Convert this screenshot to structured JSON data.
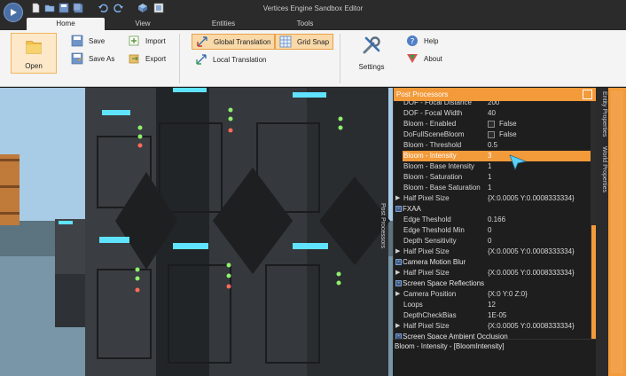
{
  "window": {
    "title": "Vertices Engine Sandbox Editor"
  },
  "menu_tabs": [
    {
      "label": "Home"
    },
    {
      "label": "View"
    },
    {
      "label": "Entities"
    },
    {
      "label": "Tools"
    }
  ],
  "ribbon": {
    "open": "Open",
    "save": "Save",
    "save_as": "Save As",
    "import": "Import",
    "export": "Export",
    "global_translation": "Global Translation",
    "local_translation": "Local Translation",
    "grid_snap": "Grid Snap",
    "settings": "Settings",
    "help": "Help",
    "about": "About"
  },
  "viewport": {
    "side_label": "Post Processors"
  },
  "panel": {
    "title": "Post Processors",
    "rows": [
      {
        "name": "DOF - Focal Distance",
        "value": "200"
      },
      {
        "name": "DOF - Focal Width",
        "value": "40"
      },
      {
        "name": "Bloom - Enabled",
        "value": "False"
      },
      {
        "name": "DoFullSceneBloom",
        "value": "False"
      },
      {
        "name": "Bloom - Threshold",
        "value": "0.5"
      },
      {
        "name": "Bloom - Intensity",
        "value": "3"
      },
      {
        "name": "Bloom - Base Intensity",
        "value": "1"
      },
      {
        "name": "Bloom - Saturation",
        "value": "1"
      },
      {
        "name": "Bloom - Base Saturation",
        "value": "1"
      },
      {
        "name": "Half Pixel Size",
        "value": "{X:0.0005 Y:0.0008333334}"
      },
      {
        "name": "FXAA",
        "value": ""
      },
      {
        "name": "Edge Theshold",
        "value": "0.166"
      },
      {
        "name": "Edge Theshold Min",
        "value": "0"
      },
      {
        "name": "Depth Sensitivity",
        "value": "0"
      },
      {
        "name": "Half Pixel Size",
        "value": "{X:0.0005 Y:0.0008333334}"
      },
      {
        "name": "Camera Motion Blur",
        "value": ""
      },
      {
        "name": "Half Pixel Size",
        "value": "{X:0.0005 Y:0.0008333334}"
      },
      {
        "name": "Screen Space Reflections",
        "value": ""
      },
      {
        "name": "Camera Position",
        "value": "{X:0 Y:0 Z:0}"
      },
      {
        "name": "Loops",
        "value": "12"
      },
      {
        "name": "DepthCheckBias",
        "value": "1E-05"
      },
      {
        "name": "Half Pixel Size",
        "value": "{X:0.0005 Y:0.0008333334}"
      },
      {
        "name": "Screen Space Ambient Occlusion",
        "value": ""
      }
    ],
    "description": "Bloom - Intensity - [BloomIntensity]"
  },
  "side_tabs": {
    "entity": "Entity Properties",
    "world": "World Properties"
  },
  "colors": {
    "accent": "#f39a3a",
    "panel_bg": "#1e1e1e",
    "ribbon_bg": "#f4f4f4"
  }
}
